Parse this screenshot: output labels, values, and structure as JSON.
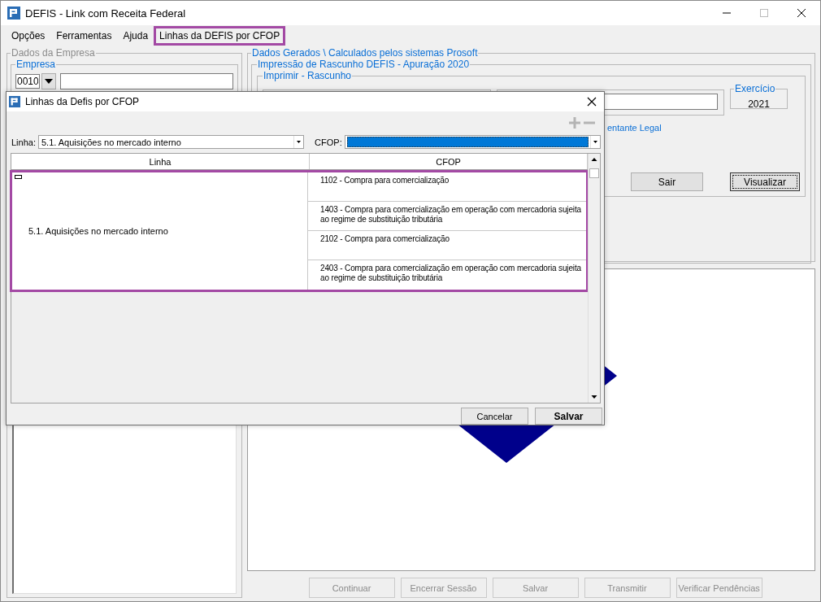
{
  "window": {
    "title": "DEFIS - Link com Receita Federal"
  },
  "menu": [
    {
      "label": "Opções",
      "highlighted": false
    },
    {
      "label": "Ferramentas",
      "highlighted": false
    },
    {
      "label": "Ajuda",
      "highlighted": false
    },
    {
      "label": "Linhas da DEFIS por CFOP",
      "highlighted": true
    }
  ],
  "company_panel": {
    "title": "Dados da Empresa",
    "company": {
      "label": "Empresa",
      "code": "0010"
    }
  },
  "generated_panel": {
    "title": "Dados Gerados \\ Calculados pelos sistemas Prosoft",
    "draft_panel": {
      "title": "Impressão de Rascunho DEFIS - Apuração 2020",
      "print_group": {
        "title": "Imprimir - Rascunho",
        "year": {
          "label": "Exercício",
          "value": "2021"
        },
        "link": "entante Legal",
        "buttons": [
          {
            "label": "Sair",
            "focused": false
          },
          {
            "label": "Visualizar",
            "focused": true
          }
        ]
      }
    }
  },
  "bottom_buttons": [
    {
      "label": "Continuar",
      "disabled": true
    },
    {
      "label": "Encerrar Sessão",
      "disabled": true
    },
    {
      "label": "Salvar",
      "disabled": true
    },
    {
      "label": "Transmitir",
      "disabled": true
    },
    {
      "label": "Verificar Pendências",
      "disabled": true
    }
  ],
  "dialog": {
    "title": "Linhas da Defis por CFOP",
    "toolbar": [
      {
        "kind": "add",
        "disabled": true
      },
      {
        "kind": "remove",
        "disabled": true
      }
    ],
    "line_filter": {
      "label": "Linha:",
      "value": "5.1. Aquisições no mercado interno"
    },
    "cfop_filter": {
      "label": "CFOP:",
      "highlighted": true
    },
    "grid": {
      "columns": [
        "Linha",
        "CFOP"
      ],
      "highlighted": true,
      "groups": [
        {
          "line": "5.1. Aquisições no mercado interno",
          "expanded": true,
          "cfops": [
            "1102 - Compra para comercialização",
            "1403 - Compra para comercialização em operação com mercadoria sujeita ao regime de substituição tributária",
            "2102 - Compra para comercialização",
            "2403 - Compra para comercialização em operação com mercadoria sujeita ao regime de substituição tributária"
          ]
        }
      ]
    },
    "buttons": [
      {
        "label": "Cancelar",
        "default": false
      },
      {
        "label": "Salvar",
        "default": true
      }
    ]
  }
}
